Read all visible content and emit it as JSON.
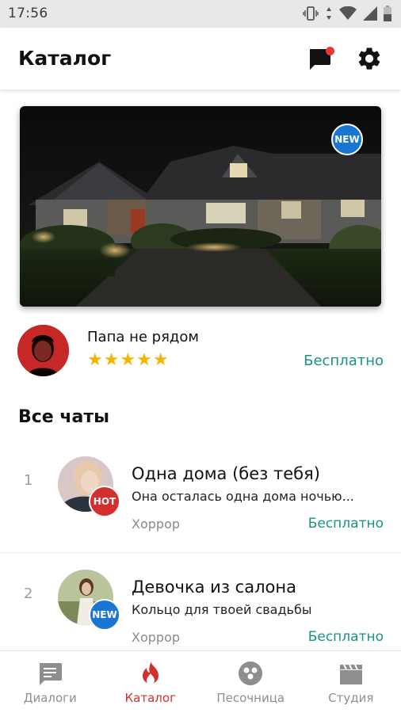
{
  "status_bar": {
    "time": "17:56",
    "icons": [
      "vibrate-icon",
      "data-arrows-icon",
      "wifi-icon",
      "signal-icon",
      "battery-icon"
    ]
  },
  "app_bar": {
    "title": "Каталог",
    "actions": [
      "chat-notification-icon",
      "settings-gear-icon"
    ]
  },
  "hero": {
    "badge": "NEW",
    "image": "night-house-photo"
  },
  "featured": {
    "title": "Папа не рядом",
    "stars": "★★★★★",
    "rating": 5,
    "price": "Бесплатно"
  },
  "section_title": "Все чаты",
  "chats": [
    {
      "index": "1",
      "title": "Одна дома (без тебя)",
      "subtitle": "Она осталась одна дома ночью...",
      "genre": "Хоррор",
      "price": "Бесплатно",
      "tag": "HOT"
    },
    {
      "index": "2",
      "title": "Девочка из салона",
      "subtitle": "Кольцо для твоей свадьбы",
      "genre": "Хоррор",
      "price": "Бесплатно",
      "tag": "NEW"
    }
  ],
  "bottom_nav": [
    {
      "label": "Диалоги",
      "icon": "chat-bubble-icon",
      "active": false
    },
    {
      "label": "Каталог",
      "icon": "flame-icon",
      "active": true
    },
    {
      "label": "Песочница",
      "icon": "community-icon",
      "active": false
    },
    {
      "label": "Студия",
      "icon": "clapperboard-icon",
      "active": false
    }
  ],
  "colors": {
    "accent": "#d32f2f",
    "price": "#179284",
    "new_badge": "#1976d2",
    "stars": "#f5b400"
  }
}
